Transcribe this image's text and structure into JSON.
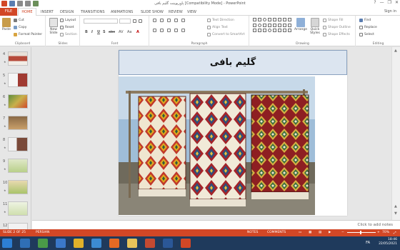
{
  "window": {
    "title": "پاورپوینت گلیم بافی [Compatibility Mode] - PowerPoint",
    "sign_in": "Sign in",
    "controls": [
      "?",
      "—",
      "❐",
      "✕"
    ]
  },
  "tabs": [
    "FILE",
    "HOME",
    "INSERT",
    "DESIGN",
    "TRANSITIONS",
    "ANIMATIONS",
    "SLIDE SHOW",
    "REVIEW",
    "VIEW"
  ],
  "ribbon": {
    "clipboard": {
      "paste": "Paste",
      "cut": "Cut",
      "copy": "Copy",
      "format_painter": "Format Painter",
      "label": "Clipboard"
    },
    "slides": {
      "new_slide": "New",
      "new_slide2": "Slide",
      "layout": "Layout",
      "reset": "Reset",
      "section": "Section",
      "label": "Slides"
    },
    "font": {
      "label": "Font",
      "buttons": [
        "B",
        "I",
        "U",
        "S",
        "abc",
        "AV",
        "Aa",
        "A"
      ]
    },
    "paragraph": {
      "text_direction": "Text Direction",
      "align_text": "Align Text",
      "convert_smartart": "Convert to SmartArt",
      "label": "Paragraph"
    },
    "drawing": {
      "arrange": "Arrange",
      "quick_styles": "Quick",
      "quick_styles2": "Styles",
      "shape_fill": "Shape Fill",
      "shape_outline": "Shape Outline",
      "shape_effects": "Shape Effects",
      "label": "Drawing"
    },
    "editing": {
      "find": "Find",
      "replace": "Replace",
      "select": "Select",
      "label": "Editing"
    }
  },
  "thumbnails": [
    {
      "num": "4"
    },
    {
      "num": "5"
    },
    {
      "num": "6"
    },
    {
      "num": "7"
    },
    {
      "num": "8"
    },
    {
      "num": "9"
    },
    {
      "num": "10"
    },
    {
      "num": "11"
    },
    {
      "num": "12"
    }
  ],
  "slide": {
    "title": "گلیم بافی"
  },
  "notes": {
    "placeholder": "Click to add notes"
  },
  "status": {
    "slide_count": "SLIDE 2 OF 25",
    "language": "PERSIAN",
    "notes_btn": "NOTES",
    "comments_btn": "COMMENTS",
    "zoom": "70%"
  },
  "taskbar": {
    "time": "18:46",
    "date": "22/05/2021",
    "lang": "FA"
  },
  "colors": {
    "accent": "#d24726",
    "taskbar": "#1f3a5c",
    "slide_title_bg": "#dce5f0"
  }
}
